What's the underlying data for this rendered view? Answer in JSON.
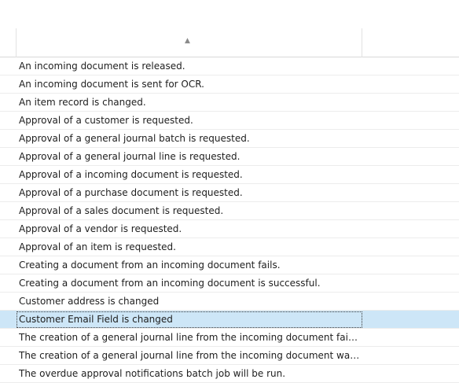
{
  "grid": {
    "sort_indicator": "▲",
    "rows": [
      "An incoming document is released.",
      "An incoming document is sent for OCR.",
      "An item record is changed.",
      "Approval of a customer is requested.",
      "Approval of a general journal batch is requested.",
      "Approval of a general journal line is requested.",
      "Approval of a incoming document is requested.",
      "Approval of a purchase document is requested.",
      "Approval of a sales document is requested.",
      "Approval of a vendor is requested.",
      "Approval of an item is requested.",
      "Creating a document from an incoming document fails.",
      "Creating a document from an incoming document is successful.",
      "Customer address is changed",
      "Customer Email Field is changed",
      "The creation of a general journal line from the incoming document failed.",
      "The creation of a general journal line from the incoming document was successf...",
      "The overdue approval notifications batch job will be run."
    ],
    "selected_index": 14
  }
}
